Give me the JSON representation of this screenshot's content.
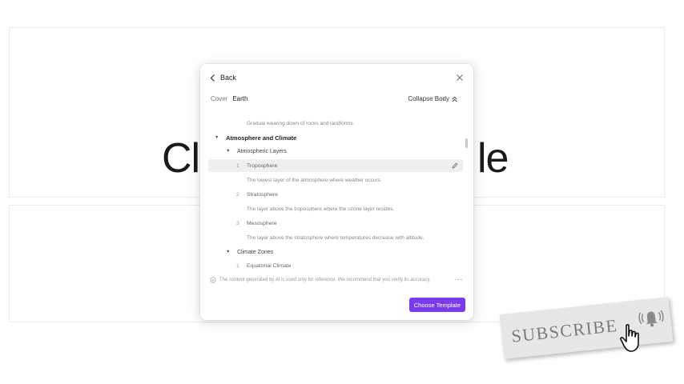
{
  "background": {
    "title_left": "Cl",
    "title_right": "le"
  },
  "dialog": {
    "back_label": "Back",
    "cover_label": "Cover",
    "cover_value": "Earth",
    "collapse_label": "Collapse Body",
    "outline": [
      {
        "kind": "desc",
        "text": "Gradual wearing down of rocks and landforms."
      },
      {
        "kind": "h1",
        "text": "Atmosphere and Climate"
      },
      {
        "kind": "h2",
        "text": "Atmospheric Layers"
      },
      {
        "kind": "item",
        "number": "1",
        "text": "Troposphere"
      },
      {
        "kind": "desc",
        "text": "The lowest layer of the atmosphere where weather occurs."
      },
      {
        "kind": "item",
        "number": "2",
        "text": "Stratosphere"
      },
      {
        "kind": "desc",
        "text": "The layer above the troposphere where the ozone layer resides."
      },
      {
        "kind": "item",
        "number": "3",
        "text": "Mesosphere"
      },
      {
        "kind": "desc",
        "text": "The layer above the stratosphere where temperatures decrease with altitude."
      },
      {
        "kind": "h2",
        "text": "Climate Zones"
      },
      {
        "kind": "item",
        "number": "1",
        "text": "Equatorial Climate"
      }
    ],
    "disclaimer": "The content generated by AI is used only for reference. We recommend that you verify its accuracy.",
    "more_label": "···",
    "choose_template_label": "Choose Template",
    "accent_color": "#7c3aed"
  },
  "overlay": {
    "subscribe_text": "SUBSCRIBE"
  }
}
